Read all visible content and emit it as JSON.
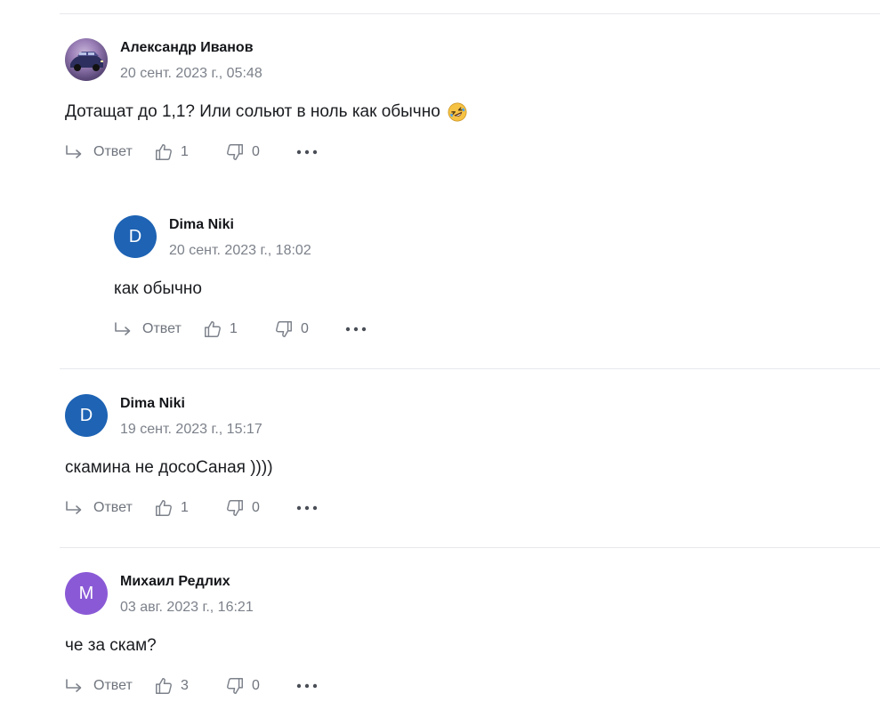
{
  "comments": [
    {
      "author": "Александр Иванов",
      "date": "20 сент. 2023 г., 05:48",
      "text": "Дотащат до 1,1? Или сольют в ноль как обычно",
      "emoji": "rolling-on-floor-laughing-emoji",
      "avatar": {
        "type": "photo",
        "icon": "car-photo-avatar"
      },
      "reply_label": "Ответ",
      "likes": "1",
      "dislikes": "0"
    },
    {
      "author": "Dima Niki",
      "date": "20 сент. 2023 г., 18:02",
      "text": "как обычно",
      "avatar": {
        "type": "letter",
        "letter": "D",
        "color": "#1e63b4"
      },
      "reply_label": "Ответ",
      "likes": "1",
      "dislikes": "0"
    },
    {
      "author": "Dima Niki",
      "date": "19 сент. 2023 г., 15:17",
      "text": "скамина не досоСаная ))))",
      "avatar": {
        "type": "letter",
        "letter": "D",
        "color": "#1e63b4"
      },
      "reply_label": "Ответ",
      "likes": "1",
      "dislikes": "0"
    },
    {
      "author": "Михаил Редлих",
      "date": "03 авг. 2023 г., 16:21",
      "text": "че за скам?",
      "avatar": {
        "type": "letter",
        "letter": "M",
        "color": "#8a5ad6"
      },
      "reply_label": "Ответ",
      "likes": "3",
      "dislikes": "0"
    }
  ],
  "icons": {
    "reply": "reply-arrow-icon",
    "like": "thumbs-up-icon",
    "dislike": "thumbs-down-icon",
    "more": "more-dots-icon"
  }
}
